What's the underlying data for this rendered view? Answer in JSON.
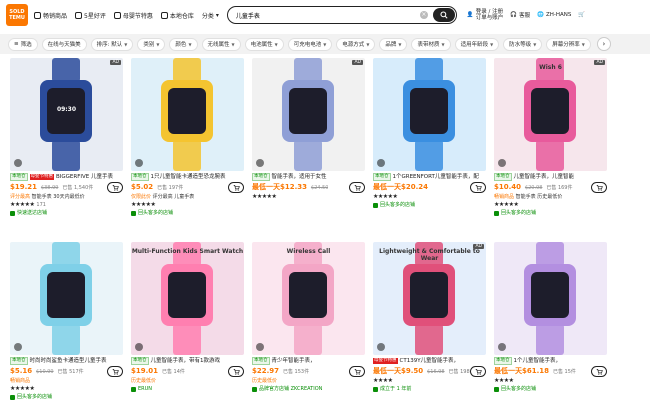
{
  "brand": {
    "logo_line1": "SOLD",
    "logo_line2": "TEMU",
    "color": "#fb7701"
  },
  "nav": [
    {
      "label": "畅销商品",
      "icon": "thumbs-up-icon"
    },
    {
      "label": "5星好评",
      "icon": "star-icon"
    },
    {
      "label": "母婴节特惠",
      "icon": "gift-icon"
    },
    {
      "label": "本地仓库",
      "icon": "truck-icon"
    },
    {
      "label": "分类",
      "icon": "chevron-down-icon"
    }
  ],
  "search": {
    "value": "儿童手表",
    "placeholder": "儿童手表"
  },
  "right_nav": {
    "orders_line1": "订单",
    "account_line1": "登录 / 注册",
    "account_line2": "订单与账户",
    "support": "客服",
    "language": "ZH-HANS"
  },
  "filters": [
    "筛选",
    "在线与天猫美",
    "排序: 默认",
    "类别",
    "颜色",
    "无线属性",
    "电池属性",
    "可充电电池",
    "电源方式",
    "品牌",
    "表带材质",
    "适用年龄段",
    "防水等级",
    "屏幕分辨率",
    "显示"
  ],
  "products": [
    {
      "bg": "#e8ecf3",
      "ad": "AD",
      "thumb_text": "09:30",
      "tag": "本地仓",
      "hot": "母婴节特惠",
      "title": "BIGGERFIVE 儿童手表",
      "price": "$19.21",
      "old": "$38.99",
      "sold": "已售 1,540件",
      "sub1": "评分最高",
      "sub2": "智能手表",
      "sub3": "30天内最低价",
      "stars": "★★★★★",
      "count": "171",
      "store": "快速送达店铺"
    },
    {
      "bg": "#dff0f9",
      "ad": "",
      "thumb_text": "",
      "tag": "本地仓",
      "hot": "",
      "title": "1只儿童智能卡通造型恐龙腕表",
      "price": "$5.02",
      "old": "",
      "sold": "已售 197件",
      "sub1": "仅限此价",
      "sub2": "评分最高",
      "sub3": "儿童手表",
      "stars": "★★★★★",
      "count": "",
      "store": "回头客多的店铺"
    },
    {
      "bg": "#f1f1f1",
      "ad": "AD",
      "thumb_text": "",
      "tag": "本地仓",
      "hot": "",
      "title": "智能手表，适用于女性",
      "price": "最低一天$12.33",
      "old": "$24.50",
      "sold": "",
      "sub1": "",
      "sub2": "",
      "sub3": "",
      "stars": "★★★★★",
      "count": "",
      "store": ""
    },
    {
      "bg": "#d7ecfb",
      "ad": "",
      "thumb_text": "",
      "tag": "本地仓",
      "hot": "",
      "title": "1个GREENFORT儿童智能手表，配",
      "price": "最低一天$20.24",
      "old": "",
      "sold": "",
      "sub1": "",
      "sub2": "",
      "sub3": "",
      "stars": "★★★★★",
      "count": "",
      "store": "回头客多的店铺"
    },
    {
      "bg": "#f6e6ec",
      "ad": "AD",
      "thumb_text": "Wish 6",
      "tag": "本地仓",
      "hot": "",
      "title": "儿童智能手表，儿童智能",
      "price": "$10.40",
      "old": "$20.98",
      "sold": "已售 169件",
      "sub1": "畅销商品",
      "sub2": "智能手表",
      "sub3": "历史最低价",
      "stars": "★★★★★",
      "count": "",
      "store": "回头客多的店铺"
    },
    {
      "bg": "#eaf4f9",
      "ad": "",
      "thumb_text": "",
      "tag": "本地仓",
      "hot": "",
      "title": "时尚时尚鲨鱼卡通造型儿童手表",
      "price": "$5.16",
      "old": "$10.99",
      "sold": "已售 517件",
      "sub1": "畅销商品",
      "sub2": "",
      "sub3": "",
      "stars": "★★★★★",
      "count": "",
      "store": "回头客多的店铺"
    },
    {
      "bg": "#f4dbe8",
      "ad": "",
      "thumb_text": "Multi-Function Kids Smart Watch",
      "tag": "本地仓",
      "hot": "",
      "title": "儿童智能手表，带有1款游戏",
      "price": "$19.01",
      "old": "",
      "sold": "已售 14件",
      "sub1": "历史最低价",
      "sub2": "",
      "sub3": "",
      "stars": "",
      "count": "",
      "store": "ERUN"
    },
    {
      "bg": "#fbe6ef",
      "ad": "",
      "thumb_text": "Wireless Call",
      "tag": "本地仓",
      "hot": "",
      "title": "青少年智能手表，",
      "price": "$22.97",
      "old": "",
      "sold": "已售 153件",
      "sub1": "历史最低价",
      "sub2": "",
      "sub3": "",
      "stars": "",
      "count": "",
      "store": "品牌官方店铺 ZKCREATION"
    },
    {
      "bg": "#e4eefb",
      "ad": "AD",
      "thumb_text": "Lightweight & Comfortable to Wear",
      "tag": "",
      "hot": "母婴节特惠",
      "title": "CT139Y儿童智能手表，",
      "price": "最低一天$9.50",
      "old": "$16.98",
      "sold": "已售 198件",
      "sub1": "",
      "sub2": "",
      "sub3": "",
      "stars": "★★★★",
      "count": "",
      "store": "成立于 1 年前"
    },
    {
      "bg": "#efe8f7",
      "ad": "",
      "thumb_text": "",
      "tag": "本地仓",
      "hot": "",
      "title": "1个儿童智能手表，",
      "price": "最低一天$61.18",
      "old": "",
      "sold": "已售 15件",
      "sub1": "",
      "sub2": "",
      "sub3": "",
      "stars": "★★★★",
      "count": "",
      "store": "回头客多的店铺"
    }
  ]
}
